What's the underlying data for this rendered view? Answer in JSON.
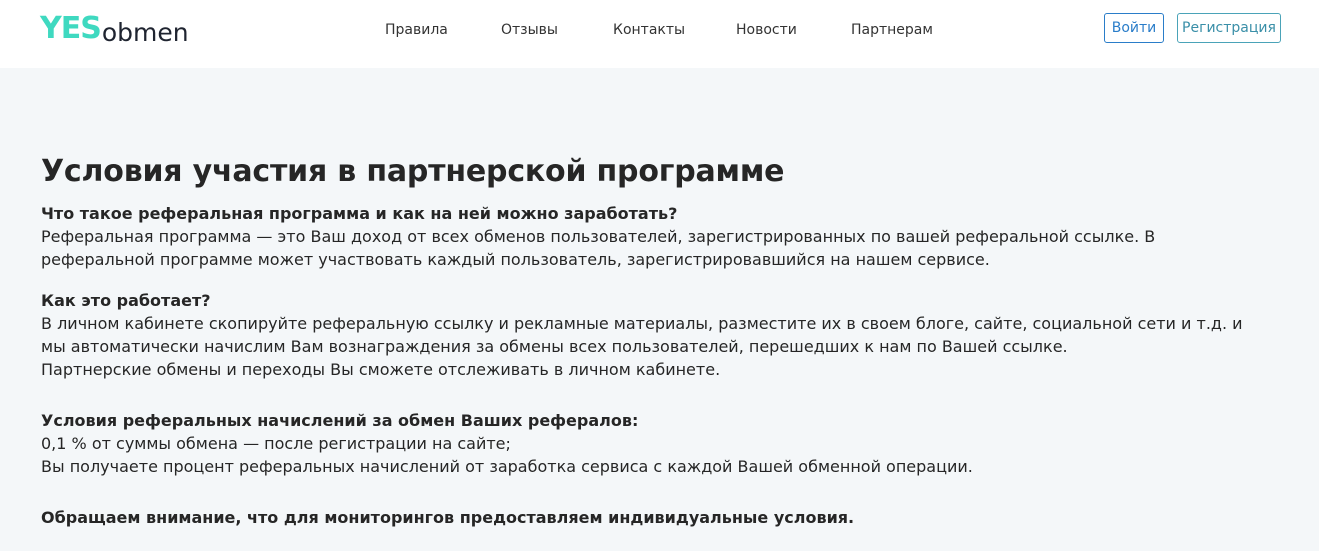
{
  "header": {
    "logo_yes": "YES",
    "logo_obmen": "obmen",
    "nav": [
      {
        "label": "Правила"
      },
      {
        "label": "Отзывы"
      },
      {
        "label": "Контакты"
      },
      {
        "label": "Новости"
      },
      {
        "label": "Партнерам"
      }
    ],
    "login_label": "Войти",
    "register_label": "Регистрация"
  },
  "main": {
    "title": "Условия участия в партнерской программе",
    "sections": [
      {
        "heading": "Что такое реферальная программа и как на ней можно заработать?",
        "lines": [
          "Реферальная программа — это Ваш доход от всех обменов пользователей, зарегистрированных по вашей реферальной ссылке. В",
          "реферальной программе может участвовать каждый пользователь, зарегистрировавшийся на нашем сервисе."
        ]
      },
      {
        "heading": "Как это работает?",
        "lines": [
          "В личном кабинете скопируйте реферальную ссылку и рекламные материалы, разместите их в своем блоге, сайте, социальной сети и т.д. и",
          "мы автоматически начислим Вам вознаграждения за обмены всех пользователей, перешедших к нам по Вашей ссылке.",
          "Партнерские обмены и переходы Вы сможете отслеживать в личном кабинете."
        ]
      },
      {
        "heading": "Условия реферальных начислений за обмен Ваших рефералов:",
        "lines": [
          "0,1 % от суммы обмена — после регистрации на сайте;",
          "Вы получаете процент реферальных начислений от заработка сервиса с каждой Вашей обменной операции."
        ]
      },
      {
        "heading": "Обращаем внимание, что для мониторингов предоставляем индивидуальные условия.",
        "lines": []
      }
    ]
  },
  "colors": {
    "accent_logo": "#3fd9c0",
    "button_border": "#2a7dc9",
    "page_background": "#f4f7f9"
  }
}
